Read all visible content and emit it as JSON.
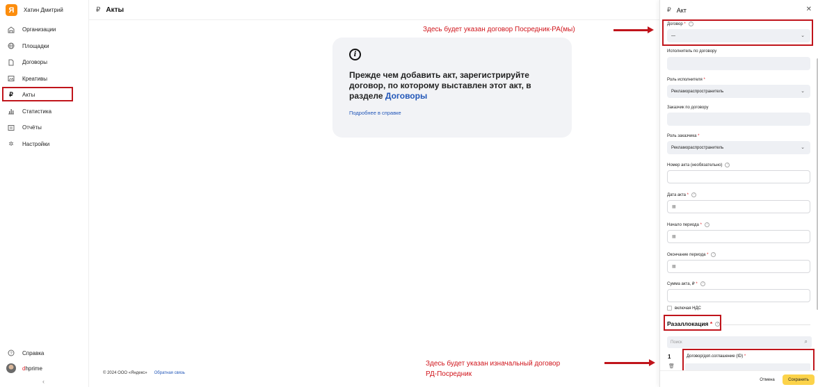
{
  "sidebar": {
    "user_name": "Хатин Дмитрий",
    "logo_letter": "Я",
    "items": [
      {
        "label": "Организации",
        "icon": "building-icon"
      },
      {
        "label": "Площадки",
        "icon": "globe-icon"
      },
      {
        "label": "Договоры",
        "icon": "document-icon"
      },
      {
        "label": "Креативы",
        "icon": "image-icon"
      },
      {
        "label": "Акты",
        "icon": "ruble-icon",
        "active": true
      },
      {
        "label": "Статистика",
        "icon": "bar-chart-icon"
      },
      {
        "label": "Отчёты",
        "icon": "report-icon"
      },
      {
        "label": "Настройки",
        "icon": "gear-icon"
      }
    ],
    "help_label": "Справка",
    "account_prefix": "d",
    "account_rest": "hprime"
  },
  "header": {
    "title": "Акты"
  },
  "card": {
    "text": "Прежде чем добавить акт, зарегистрируйте договор, по которому выставлен этот акт, в разделе ",
    "link": "Договоры",
    "help_link": "Подробнее в справке"
  },
  "footer": {
    "copyright": "© 2024 ООО «Яндекс»",
    "feedback": "Обратная связь"
  },
  "annotations": {
    "top": "Здесь будет указан договор Посредник-РА(мы)",
    "bottom_line1": "Здесь будет указан изначальный договор",
    "bottom_line2": "РД-Посредник",
    "color": "#c0141b"
  },
  "panel": {
    "title": "Акт",
    "contract_label": "Договор",
    "contract_value": "—",
    "contractor_label": "Исполнитель по договору",
    "contractor_role_label": "Роль исполнителя",
    "contractor_role_value": "Рекламораспространитель",
    "client_label": "Заказчик по договору",
    "client_role_label": "Роль заказчика",
    "client_role_value": "Рекламораспространитель",
    "act_number_label": "Номер акта (необязательно)",
    "act_date_label": "Дата акта",
    "period_start_label": "Начало периода",
    "period_end_label": "Окончание периода",
    "amount_label": "Сумма акта, ₽",
    "vat_label": "включая НДС",
    "realloc_label": "Разаллокация",
    "search_placeholder": "Поиск",
    "row_number": "1",
    "table_header": "Договор/доп.соглашение (ID)",
    "cancel_label": "Отмена",
    "save_label": "Сохранить"
  },
  "colors": {
    "accent": "#fcd34a",
    "logo": "#fc8d0d",
    "link": "#2156b8",
    "required": "#e01e25"
  }
}
